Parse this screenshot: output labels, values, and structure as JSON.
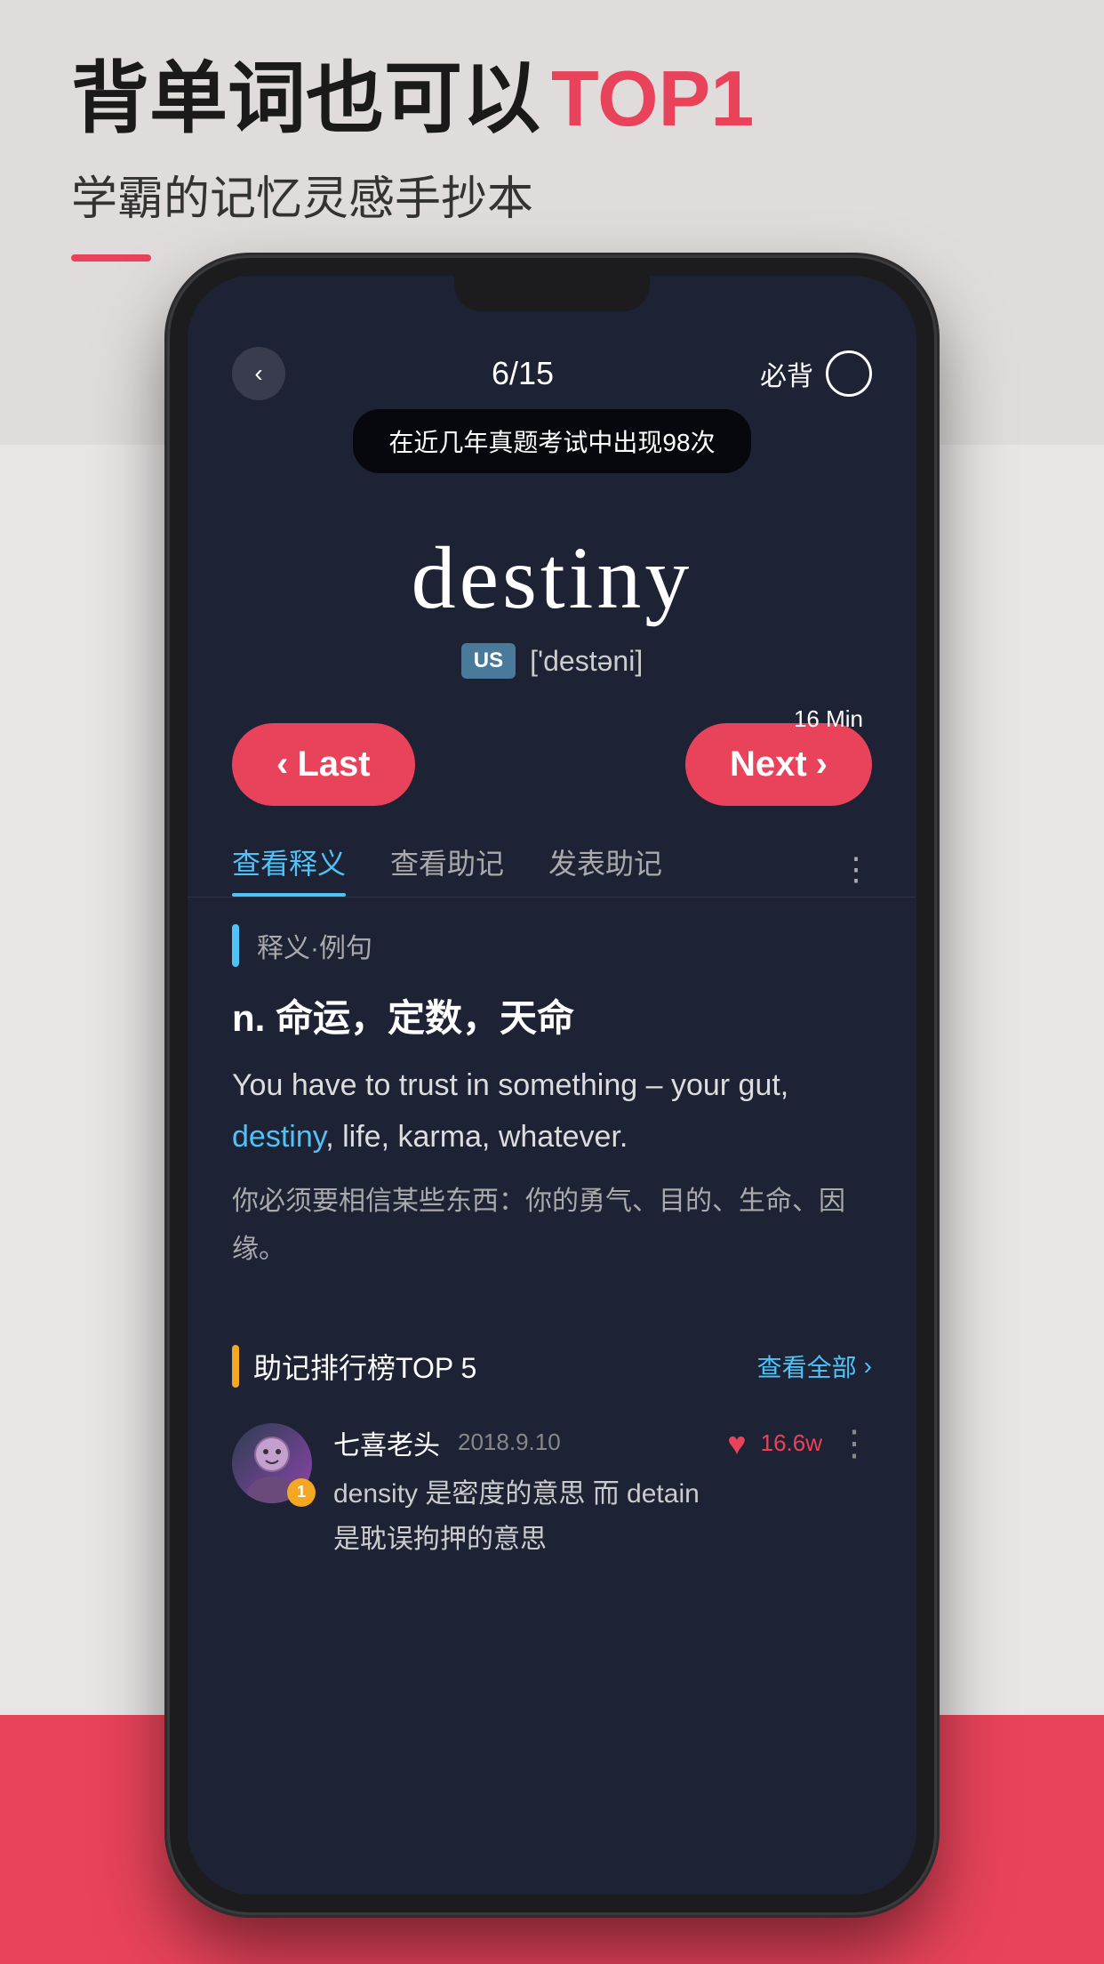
{
  "header": {
    "title_prefix": "背单词也可以",
    "title_highlight": "TOP1",
    "subtitle": "学霸的记忆灵感手抄本"
  },
  "phone": {
    "progress": "6/15",
    "must_memorize": "必背",
    "tooltip": "在近几年真题考试中出现98次",
    "word": "destiny",
    "phonetic_tag": "US",
    "phonetic": "['destəni]",
    "time_label": "16 Min",
    "btn_last": "< Last",
    "btn_next": "Next >",
    "tabs": [
      {
        "label": "查看释义",
        "active": true
      },
      {
        "label": "查看助记",
        "active": false
      },
      {
        "label": "发表助记",
        "active": false
      }
    ],
    "definition": {
      "section_label": "释义·例句",
      "pos": "n.  命运，定数，天命",
      "example_en_parts": [
        {
          "text": "You have to trust in something – your gut, ",
          "highlight": false
        },
        {
          "text": "destiny",
          "highlight": true
        },
        {
          "text": ", life, karma, whatever.",
          "highlight": false
        }
      ],
      "example_cn": "你必须要相信某些东西：你的勇气、目的、生命、因缘。"
    },
    "mnemonics": {
      "section_label": "助记排行榜TOP 5",
      "view_all": "查看全部",
      "users": [
        {
          "rank": 1,
          "username": "七喜老头",
          "date": "2018.9.10",
          "likes": "16.6w",
          "content": "density 是密度的意思 而 detain 是耽误拘押的意思"
        }
      ]
    }
  }
}
